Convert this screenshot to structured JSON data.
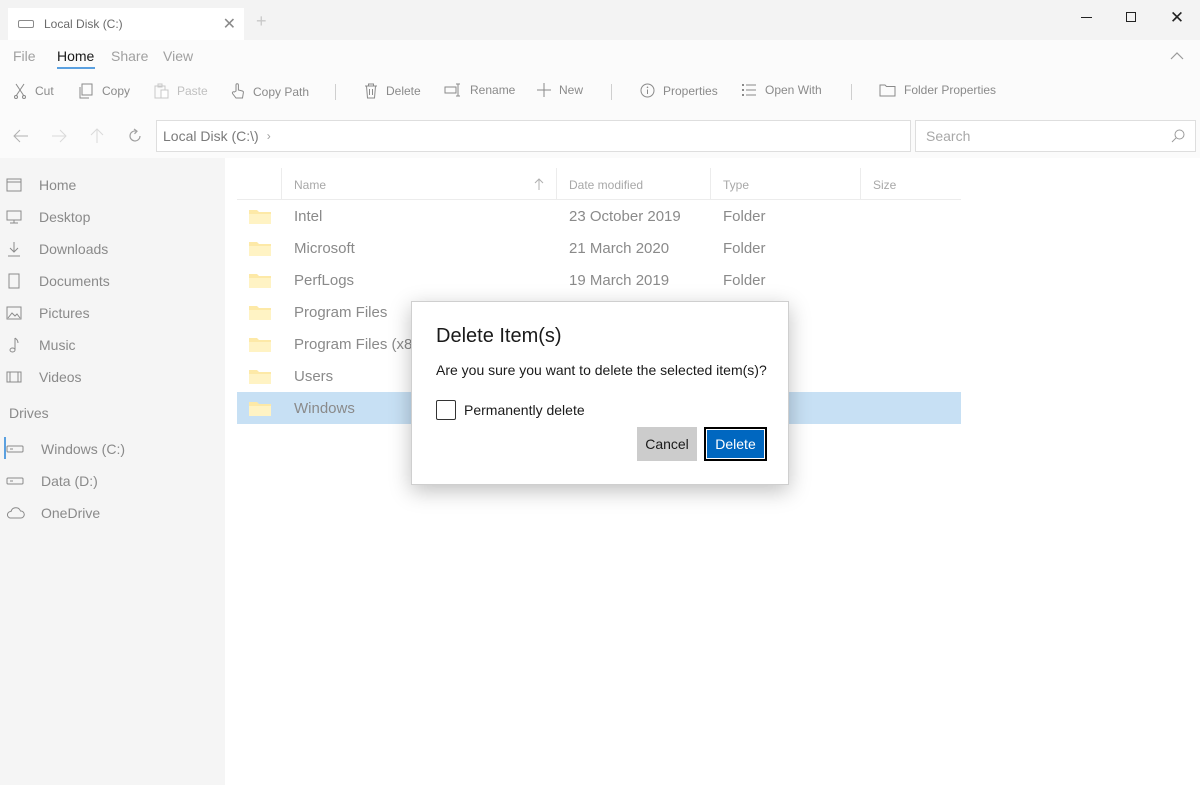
{
  "window": {
    "tab_title": "Local Disk (C:)",
    "tab_add": "+",
    "close_glyph": "✕"
  },
  "ribbon": {
    "tabs": [
      "File",
      "Home",
      "Share",
      "View"
    ],
    "active_tab": "Home",
    "tools": {
      "cut": "Cut",
      "copy": "Copy",
      "paste": "Paste",
      "copy_path": "Copy Path",
      "delete": "Delete",
      "rename": "Rename",
      "new": "New",
      "properties": "Properties",
      "open_with": "Open With",
      "folder_properties": "Folder Properties"
    }
  },
  "address": {
    "path": "Local Disk (C:\\)",
    "chevron": "›",
    "search_placeholder": "Search"
  },
  "sidebar": {
    "items": [
      "Home",
      "Desktop",
      "Downloads",
      "Documents",
      "Pictures",
      "Music",
      "Videos"
    ],
    "drives_heading": "Drives",
    "drives": [
      "Windows (C:)",
      "Data (D:)",
      "OneDrive"
    ]
  },
  "file_list": {
    "columns": [
      "Name",
      "Date modified",
      "Type",
      "Size"
    ],
    "rows": [
      {
        "name": "Intel",
        "date": "23 October 2019",
        "type": "Folder"
      },
      {
        "name": "Microsoft",
        "date": "21 March 2020",
        "type": "Folder"
      },
      {
        "name": "PerfLogs",
        "date": "19 March 2019",
        "type": "Folder"
      },
      {
        "name": "Program Files",
        "date": "",
        "type": ""
      },
      {
        "name": "Program Files (x86)",
        "date": "",
        "type": ""
      },
      {
        "name": "Users",
        "date": "",
        "type": ""
      },
      {
        "name": "Windows",
        "date": "",
        "type": ""
      }
    ],
    "selected_row": "Windows"
  },
  "dialog": {
    "title": "Delete Item(s)",
    "message": "Are you sure you want to delete the selected item(s)?",
    "checkbox_label": "Permanently delete",
    "checkbox_checked": false,
    "cancel_label": "Cancel",
    "delete_label": "Delete"
  },
  "colors": {
    "accent": "#0067c0",
    "selection": "#c7e0f4",
    "folder": "#fde9a7"
  }
}
